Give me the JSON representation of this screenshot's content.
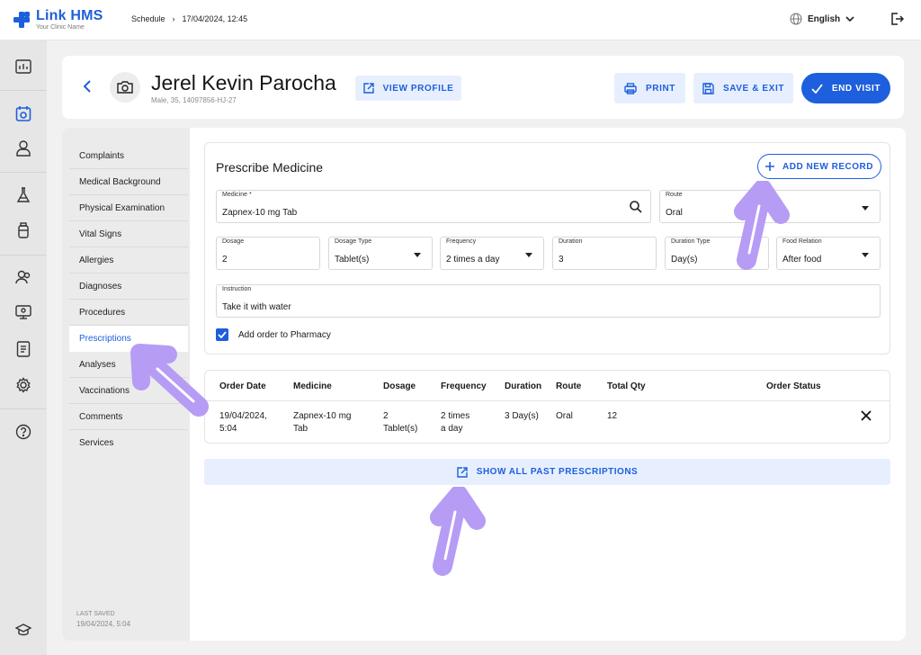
{
  "app": {
    "name": "Link HMS",
    "subtitle": "Your Clinic Name"
  },
  "breadcrumb": {
    "section": "Schedule",
    "separator": "›",
    "current": "17/04/2024, 12:45"
  },
  "language": {
    "selected": "English"
  },
  "patient": {
    "name": "Jerel Kevin Parocha",
    "info": "Male, 35, 14097856-HJ-27"
  },
  "actions": {
    "view_profile": "VIEW PROFILE",
    "print": "PRINT",
    "save_exit": "SAVE & EXIT",
    "end_visit": "END VISIT"
  },
  "menu": {
    "items": [
      "Complaints",
      "Medical Background",
      "Physical Examination",
      "Vital Signs",
      "Allergies",
      "Diagnoses",
      "Procedures",
      "Prescriptions",
      "Analyses",
      "Vaccinations",
      "Comments",
      "Services"
    ],
    "active": "Prescriptions"
  },
  "last_saved": {
    "label": "LAST SAVED",
    "value": "19/04/2024, 5:04"
  },
  "prescribe": {
    "title": "Prescribe Medicine",
    "add_new": "ADD NEW RECORD",
    "medicine": {
      "label": "Medicine *",
      "value": "Zapnex-10 mg Tab"
    },
    "route": {
      "label": "Route",
      "value": "Oral"
    },
    "dosage": {
      "label": "Dosage",
      "value": "2"
    },
    "dosage_type": {
      "label": "Dosage Type",
      "value": "Tablet(s)"
    },
    "frequency": {
      "label": "Frequency",
      "value": "2 times a day"
    },
    "duration": {
      "label": "Duration",
      "value": "3"
    },
    "duration_type": {
      "label": "Duration Type",
      "value": "Day(s)"
    },
    "food_relation": {
      "label": "Food Relation",
      "value": "After food"
    },
    "instruction": {
      "label": "Instruction",
      "value": "Take it with water"
    },
    "pharmacy": {
      "label": "Add order to Pharmacy",
      "checked": true
    }
  },
  "orders": {
    "headers": [
      "Order Date",
      "Medicine",
      "Dosage",
      "Frequency",
      "Duration",
      "Route",
      "Total Qty",
      "Order Status"
    ],
    "rows": [
      {
        "date1": "19/04/2024,",
        "date2": "5:04",
        "med1": "Zapnex-10 mg",
        "med2": "Tab",
        "dos1": "2",
        "dos2": "Tablet(s)",
        "freq1": "2 times",
        "freq2": "a day",
        "duration": "3 Day(s)",
        "route": "Oral",
        "total_qty": "12",
        "status": ""
      }
    ]
  },
  "show_all": "SHOW ALL PAST PRESCRIPTIONS",
  "colors": {
    "primary": "#1d5fdc",
    "light": "#e7efff",
    "annotation": "#b69cf5"
  },
  "icons": [
    "logo-cross-icon",
    "globe-icon",
    "chevron-down-icon",
    "logout-icon",
    "dashboard-icon",
    "calendar-icon",
    "person-icon",
    "flask-icon",
    "bottle-icon",
    "users-icon",
    "monitor-icon",
    "report-icon",
    "gear-icon",
    "help-icon",
    "graduation-cap-icon",
    "back-arrow-icon",
    "camera-icon",
    "external-link-icon",
    "printer-icon",
    "save-icon",
    "check-icon",
    "plus-icon",
    "search-icon",
    "close-icon"
  ]
}
